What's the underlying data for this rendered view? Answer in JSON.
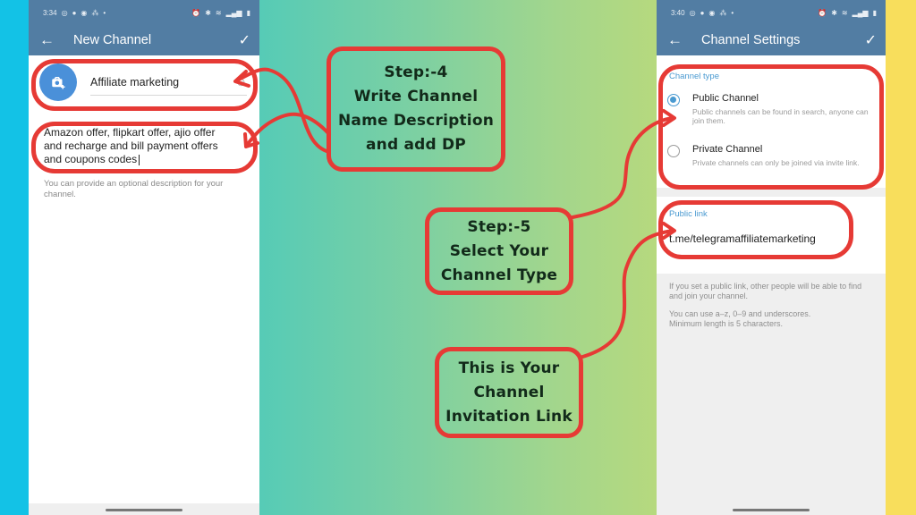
{
  "left_phone": {
    "status_time": "3:34",
    "title": "New Channel",
    "channel_name": "Affiliate marketing",
    "description_lines": [
      "Amazon offer, flipkart offer, ajio offer",
      "and recharge and bill payment offers",
      "and coupons codes"
    ],
    "description_hint": "You can provide an optional description for your channel."
  },
  "right_phone": {
    "status_time": "3:40",
    "title": "Channel Settings",
    "channel_type_title": "Channel type",
    "options": [
      {
        "label": "Public Channel",
        "sub": "Public channels can be found in search, anyone can join them.",
        "checked": true
      },
      {
        "label": "Private Channel",
        "sub": "Private channels can only be joined via invite link.",
        "checked": false
      }
    ],
    "public_link_title": "Public link",
    "public_link_value": "t.me/telegramaffiliatemarketing",
    "info_1": "If you set a public link, other people will be able to find and join your channel.",
    "info_2_lines": [
      "You can use a–z, 0–9 and underscores.",
      "Minimum length is 5 characters."
    ]
  },
  "annotations": {
    "step4": [
      "Step:-4",
      "Write Channel",
      "Name Description",
      "and add DP"
    ],
    "step5": [
      "Step:-5",
      "Select Your",
      "Channel Type"
    ],
    "invite": [
      "This is Your",
      "Channel",
      "Invitation Link"
    ]
  },
  "colors": {
    "appbar": "#527da3",
    "accent": "#4a9ad1",
    "annotation_red": "#e63a35"
  }
}
